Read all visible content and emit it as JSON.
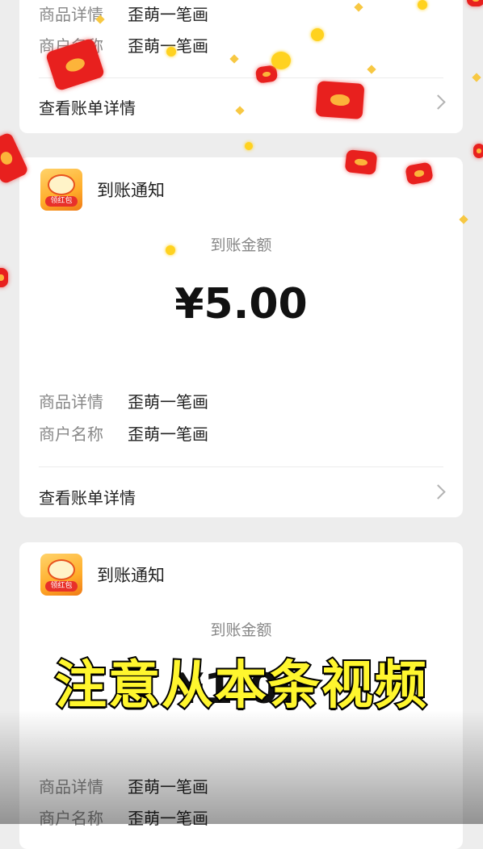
{
  "cards": [
    {
      "title": "到账通知",
      "amount_label": "到账金额",
      "amount": "",
      "detail_rows": [
        {
          "label": "商品详情",
          "value": "歪萌一笔画"
        },
        {
          "label": "商户名称",
          "value": "歪萌一笔画"
        }
      ],
      "bill_link": "查看账单详情"
    },
    {
      "title": "到账通知",
      "amount_label": "到账金额",
      "amount": "¥5.00",
      "icon_badge": "领红包",
      "detail_rows": [
        {
          "label": "商品详情",
          "value": "歪萌一笔画"
        },
        {
          "label": "商户名称",
          "value": "歪萌一笔画"
        }
      ],
      "bill_link": "查看账单详情"
    },
    {
      "title": "到账通知",
      "amount_label": "到账金额",
      "amount": "¥1.00",
      "icon_badge": "领红包",
      "detail_rows": [
        {
          "label": "商品详情",
          "value": "歪萌一笔画"
        },
        {
          "label": "商户名称",
          "value": "歪萌一笔画"
        }
      ],
      "bill_link": ""
    }
  ],
  "caption": "注意从本条视频",
  "colors": {
    "background": "#ededed",
    "card": "#ffffff",
    "caption_fill": "#fff62e",
    "caption_stroke": "#000000",
    "red_envelope": "#e8201e",
    "coin": "#ffd21f"
  },
  "icons": {
    "app_icon": "red-packet-app-icon",
    "chevron": "chevron-right-icon",
    "decorations": "falling-red-envelope-icon"
  }
}
